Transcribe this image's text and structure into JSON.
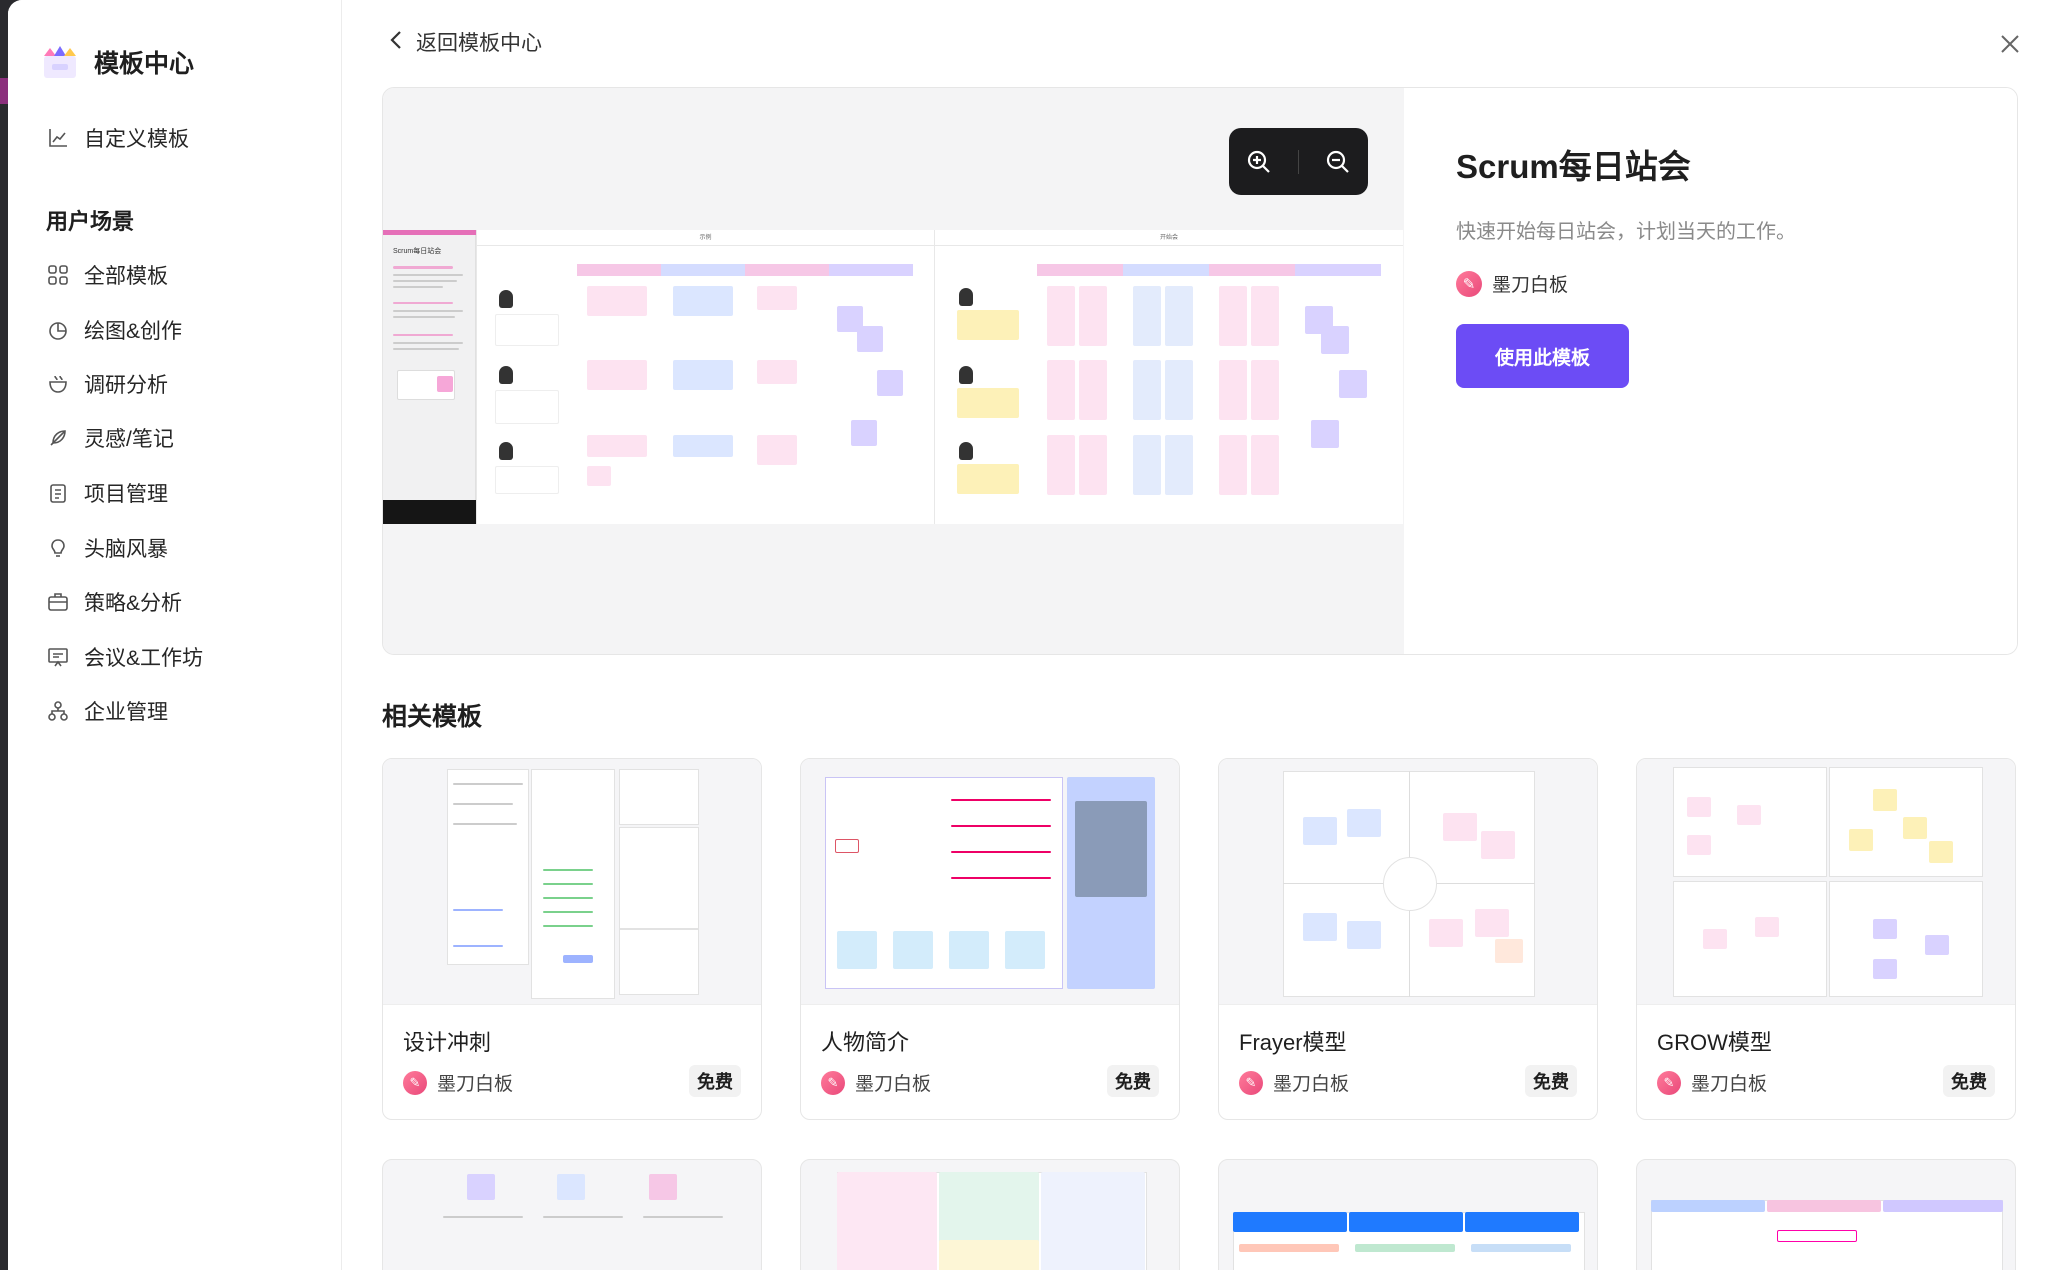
{
  "sidebar": {
    "title": "模板中心",
    "custom_templates": "自定义模板",
    "section_label": "用户场景",
    "items": [
      {
        "label": "全部模板",
        "icon": "grid-icon"
      },
      {
        "label": "绘图&创作",
        "icon": "pie-chart-icon"
      },
      {
        "label": "调研分析",
        "icon": "cup-icon"
      },
      {
        "label": "灵感/笔记",
        "icon": "feather-icon"
      },
      {
        "label": "项目管理",
        "icon": "clipboard-icon"
      },
      {
        "label": "头脑风暴",
        "icon": "lightbulb-icon"
      },
      {
        "label": "策略&分析",
        "icon": "briefcase-icon"
      },
      {
        "label": "会议&工作坊",
        "icon": "presentation-icon"
      },
      {
        "label": "企业管理",
        "icon": "org-chart-icon"
      }
    ]
  },
  "header": {
    "back_label": "返回模板中心"
  },
  "hero": {
    "title": "Scrum每日站会",
    "description": "快速开始每日站会，计划当天的工作。",
    "author": "墨刀白板",
    "use_button": "使用此模板",
    "preview_board_title": "Scrum每日站会",
    "lane_left": "示例",
    "lane_right": "开始会"
  },
  "related": {
    "title": "相关模板",
    "cards": [
      {
        "title": "设计冲刺",
        "author": "墨刀白板",
        "badge": "免费"
      },
      {
        "title": "人物简介",
        "author": "墨刀白板",
        "badge": "免费"
      },
      {
        "title": "Frayer模型",
        "author": "墨刀白板",
        "badge": "免费"
      },
      {
        "title": "GROW模型",
        "author": "墨刀白板",
        "badge": "免费"
      }
    ]
  },
  "colors": {
    "primary": "#6c4cf5",
    "pink": "#e56fb8",
    "yellow_note": "#fdf1b8",
    "blue_note": "#dbe6ff",
    "purple_note": "#d9d2ff"
  }
}
